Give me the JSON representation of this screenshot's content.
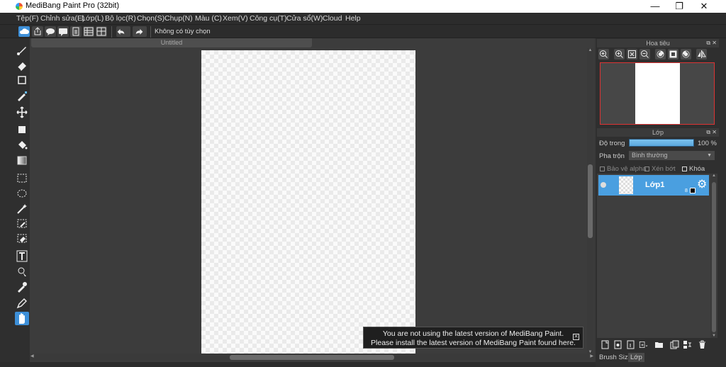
{
  "window": {
    "title": "MediBang Paint Pro (32bit)",
    "minimize": "—",
    "restore": "❐",
    "close": "✕"
  },
  "menu": [
    "Tệp(F)",
    "Chỉnh sửa(E)",
    "Lớp(L)",
    "Bộ lọc(R)",
    "Chọn(S)",
    "Chụp(N)",
    "Màu (C)",
    "Xem(V)",
    "Công cụ(T)",
    "Cửa sổ(W)",
    "Cloud",
    "Help"
  ],
  "toolbar": {
    "no_options": "Không có tùy chọn"
  },
  "document": {
    "tab_title": "Untitled"
  },
  "notice": {
    "line1": "You are not using the latest version of MediBang Paint.",
    "line2": "Please install the latest version of MediBang Paint found here.",
    "close": "✕"
  },
  "navigator": {
    "title": "Hoa tiêu"
  },
  "layers_panel": {
    "title": "Lớp",
    "opacity_label": "Độ trong",
    "opacity_value": "100 %",
    "opacity": 1.0,
    "blend_label": "Pha trộn",
    "blend_value": "Bình thường",
    "protect_alpha": "Bảo vệ alpha",
    "clipping": "Xén bớt",
    "lock": "Khóa",
    "layers": [
      {
        "name": "Lớp1",
        "badge": "8"
      }
    ]
  },
  "bottom_tabs": [
    "Brush Size",
    "Lớp"
  ],
  "panel_buttons": "⧉ ✕",
  "colors": {
    "accent": "#4a9fe0",
    "navigator_border": "#dd3333"
  }
}
